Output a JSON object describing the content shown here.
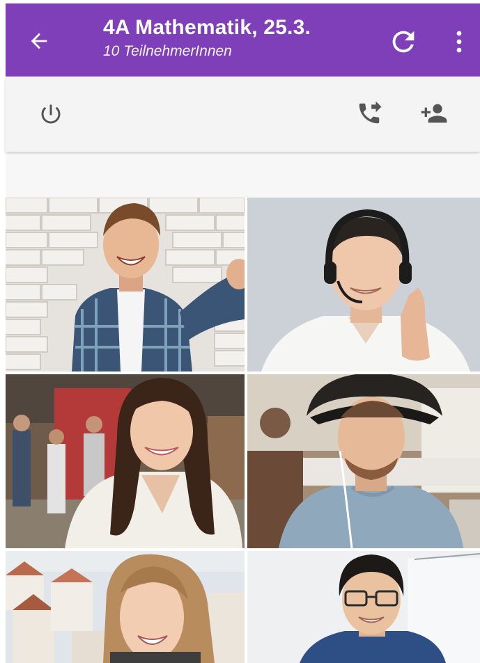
{
  "header": {
    "back_icon": "arrow-back-icon",
    "title": "4A Mathematik, 25.3.",
    "subtitle": "10 TeilnehmerInnen",
    "refresh_icon": "refresh-icon",
    "more_icon": "more-vert-icon",
    "background_color": "#7e3fb8"
  },
  "toolbar": {
    "power_icon": "power-icon",
    "call_icon": "phone-forwarded-icon",
    "add_person_icon": "person-add-icon"
  },
  "participants": [
    {
      "icon": "participant-video"
    },
    {
      "icon": "participant-video"
    },
    {
      "icon": "participant-video"
    },
    {
      "icon": "participant-video"
    },
    {
      "icon": "participant-video"
    },
    {
      "icon": "participant-video"
    }
  ]
}
